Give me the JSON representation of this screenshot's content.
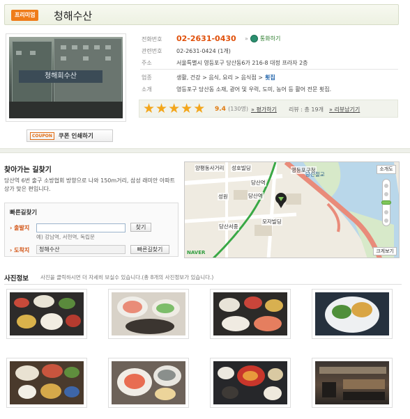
{
  "header": {
    "badge": "프리미엄",
    "title": "청해수산"
  },
  "store": {
    "photo_sign": "청해회수산",
    "coupon_tag": "COUPON",
    "coupon_label": "쿠폰 인쇄하기"
  },
  "info": {
    "phone_label": "전화번호",
    "phone": "02-2631-0430",
    "call_label": "통화하기",
    "related_label": "관련번호",
    "related": "02-2631-0424 (1개)",
    "address_label": "주소",
    "address": "서울특별시 영등포구 당산동6가 216-8 대정 프라자 2층",
    "category_label": "업종",
    "category": "생활, 건강 > 음식, 요리 > 음식점 >",
    "category_chip": "횟집",
    "intro_label": "소개",
    "intro": "영등포구 당산동 소재, 광어 및 우럭, 도미, 농어 등 활어 전문 횟집."
  },
  "rating": {
    "stars": 5,
    "score": "9.4",
    "count": "(130명)",
    "rate_link": "평가하기",
    "review_text": "리뷰 : 총 19개",
    "review_link": "리뷰남기기"
  },
  "directions": {
    "title": "찾아가는 길찾기",
    "desc": "당산역 6번 출구 소방협회 방향으로 나와 150m거리, 삼성 래미안 아파트 상가 맞은 편입니다.",
    "quick_title": "빠른길찾기",
    "from_label": "출발지",
    "from_value": "",
    "search_btn": "찾기",
    "example": "예) 강남역, 서현역, 독립문",
    "to_label": "도착지",
    "to_value": "청해수산",
    "route_btn": "빠른길찾기"
  },
  "map": {
    "zoom_top": "소개도",
    "labels": [
      "양평동사거리",
      "성호빌딩",
      "영등포구청",
      "당산역",
      "당산역",
      "성원",
      "당산서중",
      "모자빌딩",
      "당산철교"
    ],
    "naver": "NAVER",
    "bigger": "크게보기"
  },
  "photos": {
    "title": "사진정보",
    "desc": "사진을 클릭하시면 더 자세히 보실수 있습니다.(총 8개의 사진정보가 있습니다.)"
  }
}
